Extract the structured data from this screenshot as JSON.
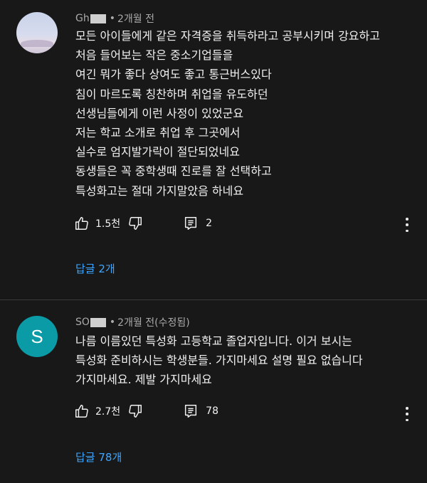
{
  "comments": [
    {
      "author": "Gh",
      "time": "2개월 전",
      "lines": [
        "모든 아이들에게 같은 자격증을 취득하라고 공부시키며 강요하고",
        "처음 들어보는 작은 중소기업들을",
        "여긴 뭐가 좋다 상여도 좋고 통근버스있다",
        "침이 마르도록 칭찬하며 취업을 유도하던",
        "선생님들에게 이런 사정이 있었군요",
        "저는 학교 소개로 취업 후 그곳에서",
        "실수로 엄지발가락이 절단되었네요",
        "동생들은 꼭 중학생때 진로를 잘 선택하고",
        "특성화고는 절대 가지말았음 하네요"
      ],
      "likes": "1.5천",
      "reply_count": "2",
      "replies_link": "답글 2개"
    },
    {
      "avatar_letter": "S",
      "author": "SO",
      "time": "2개월 전(수정됨)",
      "lines": [
        "나름 이름있던 특성화 고등학교 졸업자입니다. 이거 보시는",
        "특성화 준비하시는 학생분들. 가지마세요 설명 필요 없습니다",
        "가지마세요. 제발 가지마세요"
      ],
      "likes": "2.7천",
      "reply_count": "78",
      "replies_link": "답글 78개"
    }
  ],
  "icons": {
    "like": "thumbs-up-icon",
    "dislike": "thumbs-down-icon",
    "reply": "comment-icon",
    "more": "more-vertical-icon"
  },
  "colors": {
    "background": "#181818",
    "text": "#f1f1f1",
    "meta": "#aaaaaa",
    "link": "#3ea6ff",
    "avatar2": "#0b9ba6"
  }
}
